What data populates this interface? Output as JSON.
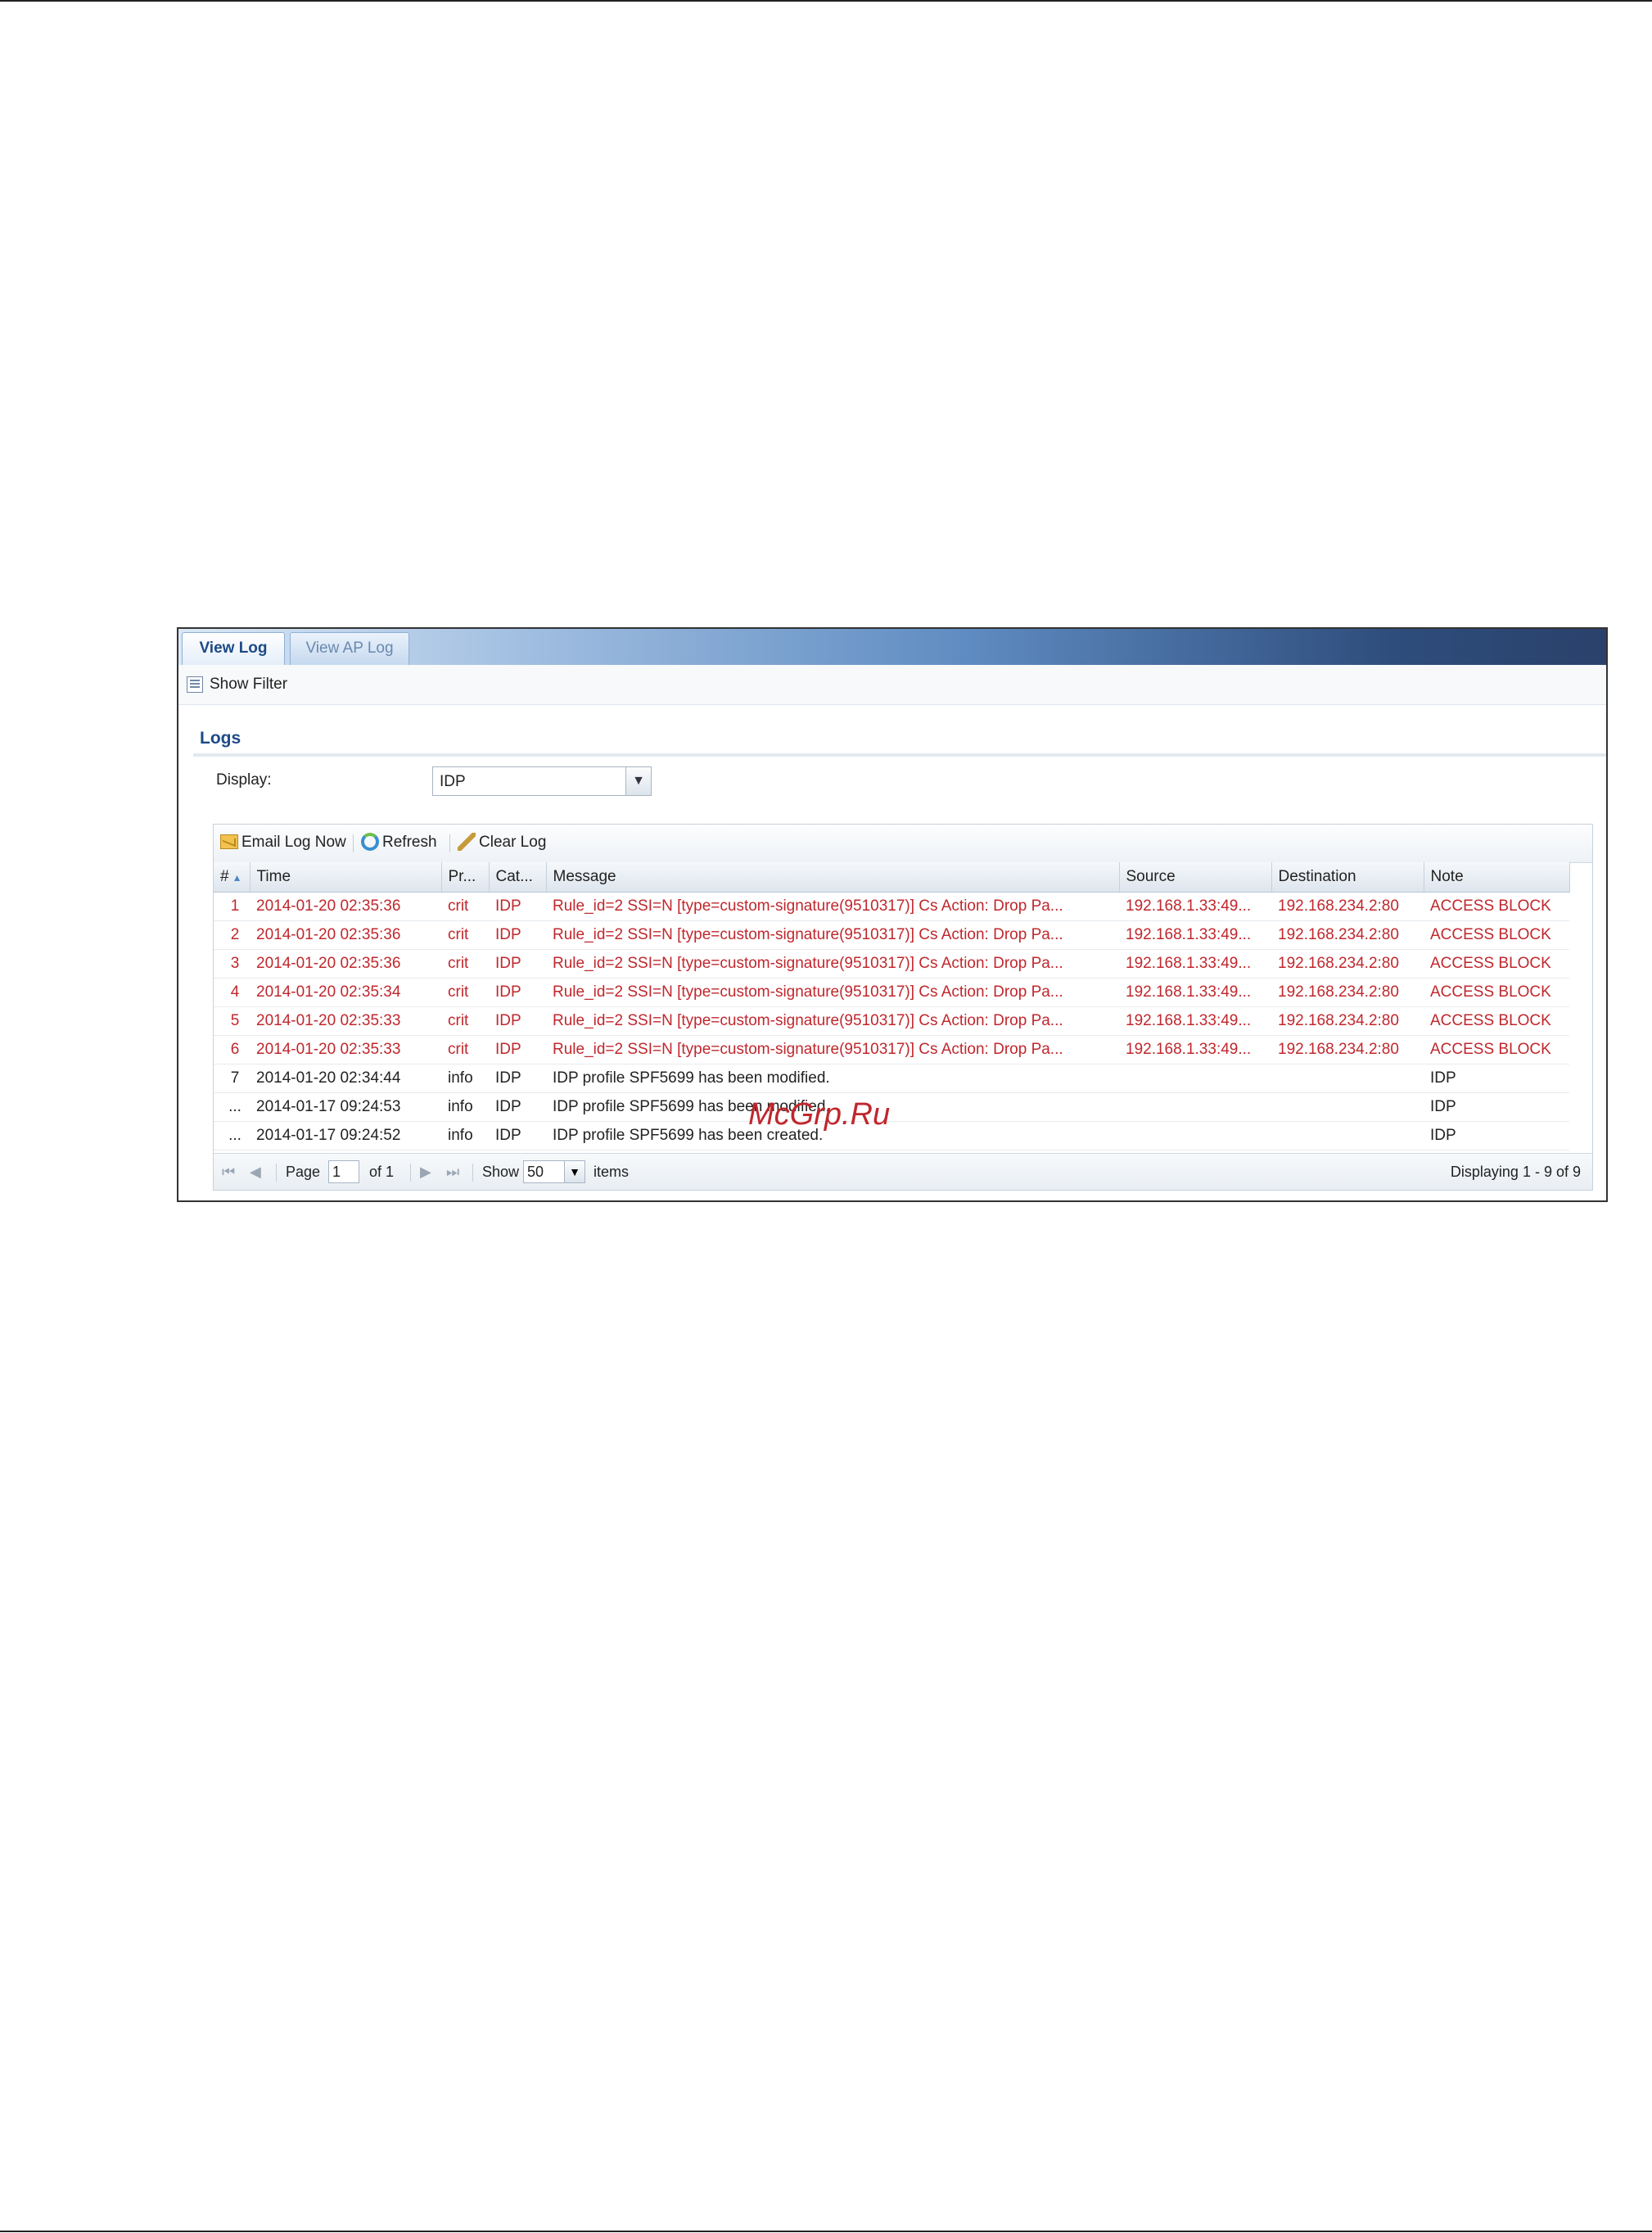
{
  "tabs": {
    "view_log": "View Log",
    "view_ap_log": "View AP Log"
  },
  "filter": {
    "label": "Show Filter"
  },
  "logs_section": {
    "title": "Logs",
    "display_label": "Display:",
    "display_value": "IDP"
  },
  "toolbar": {
    "email": "Email Log Now",
    "refresh": "Refresh",
    "clear": "Clear Log"
  },
  "columns": [
    "#",
    "Time",
    "Pr...",
    "Cat...",
    "Message",
    "Source",
    "Destination",
    "Note"
  ],
  "rows": [
    {
      "num": "1",
      "time": "2014-01-20 02:35:36",
      "priority": "crit",
      "category": "IDP",
      "message": "Rule_id=2 SSI=N [type=custom-signature(9510317)] Cs Action: Drop Pa...",
      "source": "192.168.1.33:49...",
      "destination": "192.168.234.2:80",
      "note": "ACCESS BLOCK"
    },
    {
      "num": "2",
      "time": "2014-01-20 02:35:36",
      "priority": "crit",
      "category": "IDP",
      "message": "Rule_id=2 SSI=N [type=custom-signature(9510317)] Cs Action: Drop Pa...",
      "source": "192.168.1.33:49...",
      "destination": "192.168.234.2:80",
      "note": "ACCESS BLOCK"
    },
    {
      "num": "3",
      "time": "2014-01-20 02:35:36",
      "priority": "crit",
      "category": "IDP",
      "message": "Rule_id=2 SSI=N [type=custom-signature(9510317)] Cs Action: Drop Pa...",
      "source": "192.168.1.33:49...",
      "destination": "192.168.234.2:80",
      "note": "ACCESS BLOCK"
    },
    {
      "num": "4",
      "time": "2014-01-20 02:35:34",
      "priority": "crit",
      "category": "IDP",
      "message": "Rule_id=2 SSI=N [type=custom-signature(9510317)] Cs Action: Drop Pa...",
      "source": "192.168.1.33:49...",
      "destination": "192.168.234.2:80",
      "note": "ACCESS BLOCK"
    },
    {
      "num": "5",
      "time": "2014-01-20 02:35:33",
      "priority": "crit",
      "category": "IDP",
      "message": "Rule_id=2 SSI=N [type=custom-signature(9510317)] Cs Action: Drop Pa...",
      "source": "192.168.1.33:49...",
      "destination": "192.168.234.2:80",
      "note": "ACCESS BLOCK"
    },
    {
      "num": "6",
      "time": "2014-01-20 02:35:33",
      "priority": "crit",
      "category": "IDP",
      "message": "Rule_id=2 SSI=N [type=custom-signature(9510317)] Cs Action: Drop Pa...",
      "source": "192.168.1.33:49...",
      "destination": "192.168.234.2:80",
      "note": "ACCESS BLOCK"
    },
    {
      "num": "7",
      "time": "2014-01-20 02:34:44",
      "priority": "info",
      "category": "IDP",
      "message": "IDP profile SPF5699 has been modified.",
      "source": "",
      "destination": "",
      "note": "IDP"
    },
    {
      "num": "...",
      "time": "2014-01-17 09:24:53",
      "priority": "info",
      "category": "IDP",
      "message": "IDP profile SPF5699 has been modified.",
      "source": "",
      "destination": "",
      "note": "IDP"
    },
    {
      "num": "...",
      "time": "2014-01-17 09:24:52",
      "priority": "info",
      "category": "IDP",
      "message": "IDP profile SPF5699 has been created.",
      "source": "",
      "destination": "",
      "note": "IDP"
    }
  ],
  "pager": {
    "page_label": "Page",
    "page_value": "1",
    "of_label": "of 1",
    "show_label": "Show",
    "show_value": "50",
    "items_label": "items",
    "displaying": "Displaying 1 - 9 of 9"
  },
  "watermark": "McGrp.Ru",
  "colors": {
    "crit_text": "#c0272d",
    "accent": "#1d4a86"
  }
}
